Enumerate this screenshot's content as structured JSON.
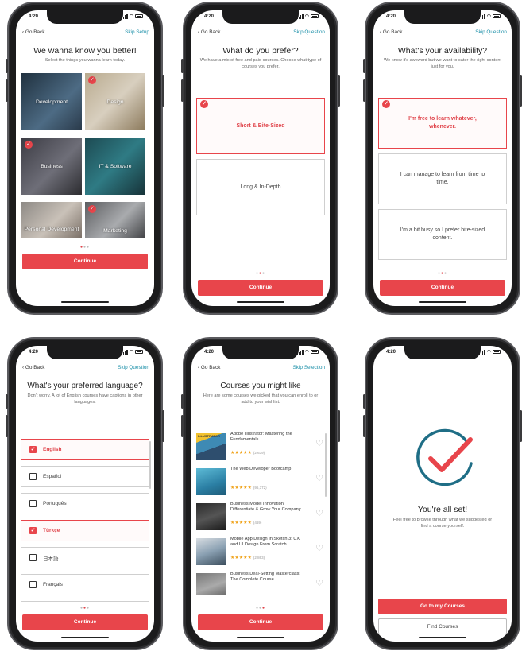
{
  "status_time": "4:20",
  "nav": {
    "back": "Go Back"
  },
  "continue_label": "Continue",
  "screen1": {
    "skip": "Skip Setup",
    "title": "We wanna know you better!",
    "subtitle": "Select the things you wanna learn today.",
    "tiles": [
      {
        "label": "Development",
        "selected": false
      },
      {
        "label": "Design",
        "selected": true
      },
      {
        "label": "Business",
        "selected": true
      },
      {
        "label": "IT & Software",
        "selected": false
      },
      {
        "label": "Personal Development",
        "selected": false
      },
      {
        "label": "Marketing",
        "selected": true
      }
    ]
  },
  "screen2": {
    "skip": "Skip Question",
    "title": "What do you prefer?",
    "subtitle": "We have a mix of free and paid courses. Choose what type of courses you prefer.",
    "options": [
      {
        "label": "Short & Bite-Sized",
        "selected": true
      },
      {
        "label": "Long & In-Depth",
        "selected": false
      }
    ]
  },
  "screen3": {
    "skip": "Skip Question",
    "title": "What's your availability?",
    "subtitle": "We know it's awkward but we want to cater the right content just for you.",
    "options": [
      {
        "label": "I'm free to learn whatever, whenever.",
        "selected": true
      },
      {
        "label": "I can manage to learn from time to time.",
        "selected": false
      },
      {
        "label": "I'm a bit busy so I prefer bite-sized content.",
        "selected": false
      }
    ]
  },
  "screen4": {
    "skip": "Skip Question",
    "title": "What's your preferred language?",
    "subtitle": "Don't worry. A lot of English courses have captions in other languages.",
    "languages": [
      {
        "label": "English",
        "selected": true
      },
      {
        "label": "Español",
        "selected": false
      },
      {
        "label": "Português",
        "selected": false
      },
      {
        "label": "Türkçe",
        "selected": true
      },
      {
        "label": "日本語",
        "selected": false
      },
      {
        "label": "Français",
        "selected": false
      }
    ]
  },
  "screen5": {
    "skip": "Skip Selection",
    "title": "Courses you might like",
    "subtitle": "Here are some courses we picked that you can enroll to or add to your wishlist.",
    "courses": [
      {
        "title": "Adobe Illustrator: Mastering the Fundamentals",
        "rating": "★★★★★",
        "count": "(2,639)",
        "thumb_label": "ILLUSTRATOR"
      },
      {
        "title": "The Web Developer Bootcamp",
        "rating": "★★★★★",
        "count": "(96,372)",
        "thumb_label": ""
      },
      {
        "title": "Business Model Innovation: Differentiate & Grow Your Company",
        "rating": "★★★★★",
        "count": "(469)",
        "thumb_label": ""
      },
      {
        "title": "Mobile App Design In Sketch 3: UX and UI Design From Scratch",
        "rating": "★★★★★",
        "count": "(2,863)",
        "thumb_label": ""
      },
      {
        "title": "Business Deal-Setting Masterclass: The Complete Course",
        "rating": "",
        "count": "",
        "thumb_label": ""
      }
    ]
  },
  "screen6": {
    "title": "You're all set!",
    "subtitle": "Feel free to browse through what we suggested or find a course yourself.",
    "primary": "Go to my Courses",
    "secondary": "Find Courses"
  },
  "colors": {
    "accent": "#e8454b",
    "link": "#1a8fa8",
    "success_ring": "#1f6e86"
  }
}
